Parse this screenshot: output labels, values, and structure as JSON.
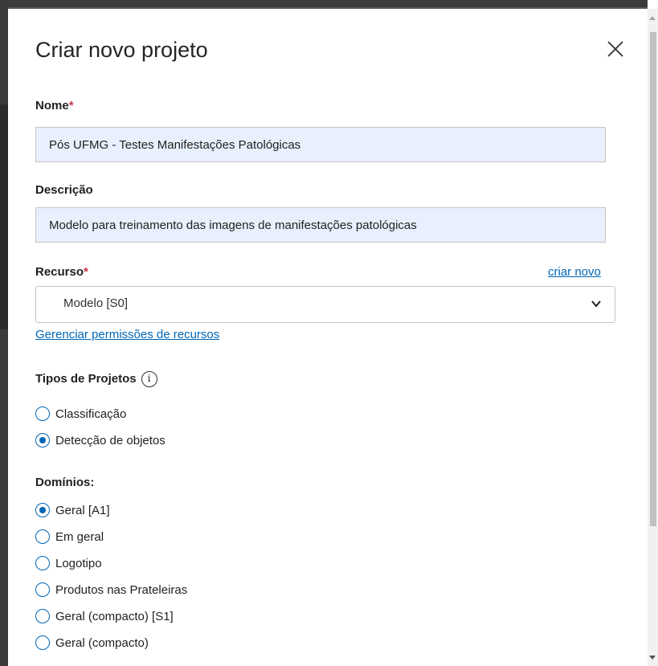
{
  "dialog": {
    "title": "Criar novo projeto"
  },
  "form": {
    "name_label": "Nome",
    "required_mark": "*",
    "name_value": "Pós UFMG - Testes Manifestações Patológicas",
    "description_label": "Descrição",
    "description_value": "Modelo para treinamento das imagens de manifestações patológicas",
    "resource_label": "Recurso",
    "create_new_link": "criar novo",
    "resource_selected": "Modelo [S0]",
    "manage_permissions_link": "Gerenciar permissões de recursos",
    "project_types_label": "Tipos de Projetos",
    "project_types": [
      {
        "label": "Classificação",
        "checked": false
      },
      {
        "label": "Detecção de objetos",
        "checked": true
      }
    ],
    "domains_label": "Domínios:",
    "domains": [
      {
        "label": "Geral [A1]",
        "checked": true
      },
      {
        "label": "Em geral",
        "checked": false
      },
      {
        "label": "Logotipo",
        "checked": false
      },
      {
        "label": "Produtos nas Prateleiras",
        "checked": false
      },
      {
        "label": "Geral (compacto) [S1]",
        "checked": false
      },
      {
        "label": "Geral (compacto)",
        "checked": false
      }
    ]
  },
  "colors": {
    "accent": "#0067b8",
    "required": "#c4314b",
    "input_fill": "#e8f0fe"
  }
}
